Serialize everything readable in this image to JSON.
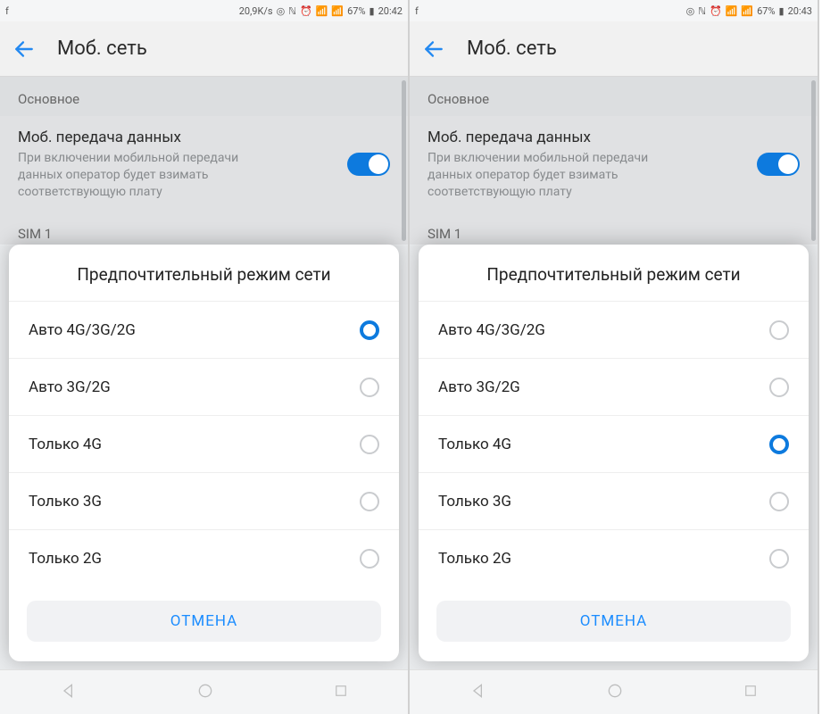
{
  "left": {
    "status": {
      "speed": "20,9K/s",
      "battery": "67%",
      "time": "20:42"
    },
    "header": {
      "title": "Моб. сеть"
    },
    "section": "Основное",
    "mobileData": {
      "title": "Моб. передача данных",
      "sub": "При включении мобильной передачи данных оператор будет взимать соответствующую плату"
    },
    "sim": "SIM 1",
    "dialog": {
      "title": "Предпочтительный режим сети",
      "options": {
        "0": {
          "label": "Авто 4G/3G/2G"
        },
        "1": {
          "label": "Авто 3G/2G"
        },
        "2": {
          "label": "Только 4G"
        },
        "3": {
          "label": "Только 3G"
        },
        "4": {
          "label": "Только 2G"
        }
      },
      "selectedIndex": 0,
      "cancel": "ОТМЕНА"
    }
  },
  "right": {
    "status": {
      "battery": "67%",
      "time": "20:43"
    },
    "header": {
      "title": "Моб. сеть"
    },
    "section": "Основное",
    "mobileData": {
      "title": "Моб. передача данных",
      "sub": "При включении мобильной передачи данных оператор будет взимать соответствующую плату"
    },
    "sim": "SIM 1",
    "dialog": {
      "title": "Предпочтительный режим сети",
      "options": {
        "0": {
          "label": "Авто 4G/3G/2G"
        },
        "1": {
          "label": "Авто 3G/2G"
        },
        "2": {
          "label": "Только 4G"
        },
        "3": {
          "label": "Только 3G"
        },
        "4": {
          "label": "Только 2G"
        }
      },
      "selectedIndex": 2,
      "cancel": "ОТМЕНА"
    }
  }
}
